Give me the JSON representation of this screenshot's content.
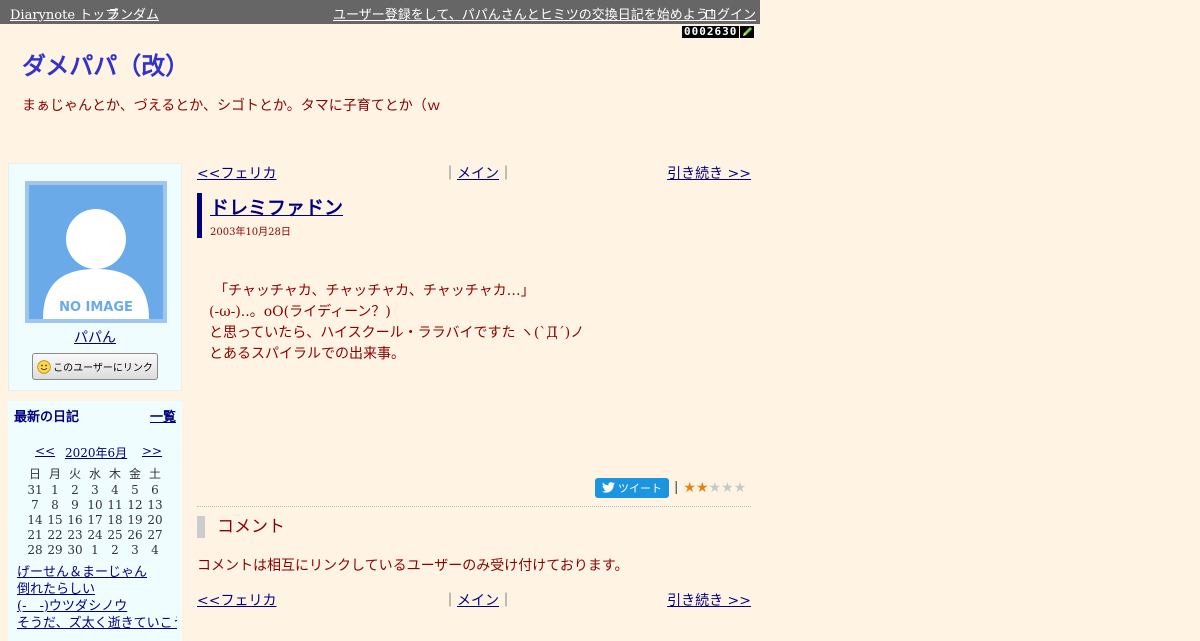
{
  "topbar": {
    "home": "Diarynote トップ",
    "random": "ランダム",
    "signup": "ユーザー登録をして、パパんさんとヒミツの交換日記を始めよう！",
    "login": "ログイン"
  },
  "counter": "0002630",
  "header": {
    "title": "ダメパパ（改）",
    "description": "まぁじゃんとか、づえるとか、シゴトとか。タマに子育てとか（ｗ"
  },
  "profile": {
    "avatar_text": "NO IMAGE",
    "name": "パパん",
    "link_button": "このユーザーにリンク"
  },
  "recent": {
    "title": "最新の日記",
    "all_link": "一覧",
    "calendar": {
      "prev": "<<",
      "month": "2020年6月",
      "next": ">>",
      "weekdays": [
        "日",
        "月",
        "火",
        "水",
        "木",
        "金",
        "土"
      ],
      "weeks": [
        [
          "31",
          "1",
          "2",
          "3",
          "4",
          "5",
          "6"
        ],
        [
          "7",
          "8",
          "9",
          "10",
          "11",
          "12",
          "13"
        ],
        [
          "14",
          "15",
          "16",
          "17",
          "18",
          "19",
          "20"
        ],
        [
          "21",
          "22",
          "23",
          "24",
          "25",
          "26",
          "27"
        ],
        [
          "28",
          "29",
          "30",
          "1",
          "2",
          "3",
          "4"
        ]
      ]
    },
    "entries": [
      "げーせん＆まーじゃん",
      "倒れたらしい",
      "(-＿-)ウツダシノウ",
      "そうだ、ズ太く逝きていこう"
    ]
  },
  "nav": {
    "prev": "<<フェリカ",
    "main": "メイン",
    "next": "引き続き >>"
  },
  "entry": {
    "title": "ドレミファドン",
    "date": "2003年10月28日",
    "lines": [
      "「チャッチャカ、チャッチャカ、チャッチャカ…」",
      "",
      "(-ω-)..。oO(ライディーン？)",
      "と思っていたら、ハイスクール・ララバイですた ヽ(`Д´)ノ",
      "",
      "とあるスパイラルでの出来事。"
    ]
  },
  "share": {
    "tweet": "ツイート",
    "rating": 2,
    "rating_max": 5
  },
  "comments": {
    "heading": "コメント",
    "note": "コメントは相互にリンクしているユーザーのみ受け付けております。"
  },
  "colors": {
    "background": "#FFF3E3",
    "title": "#3333CC",
    "text": "#8B0000",
    "link": "#000080",
    "sidebar": "#F0FDFF",
    "tweet": "#1B95E0",
    "star_on": "#E8830F",
    "star_off": "#C8C8C8"
  }
}
